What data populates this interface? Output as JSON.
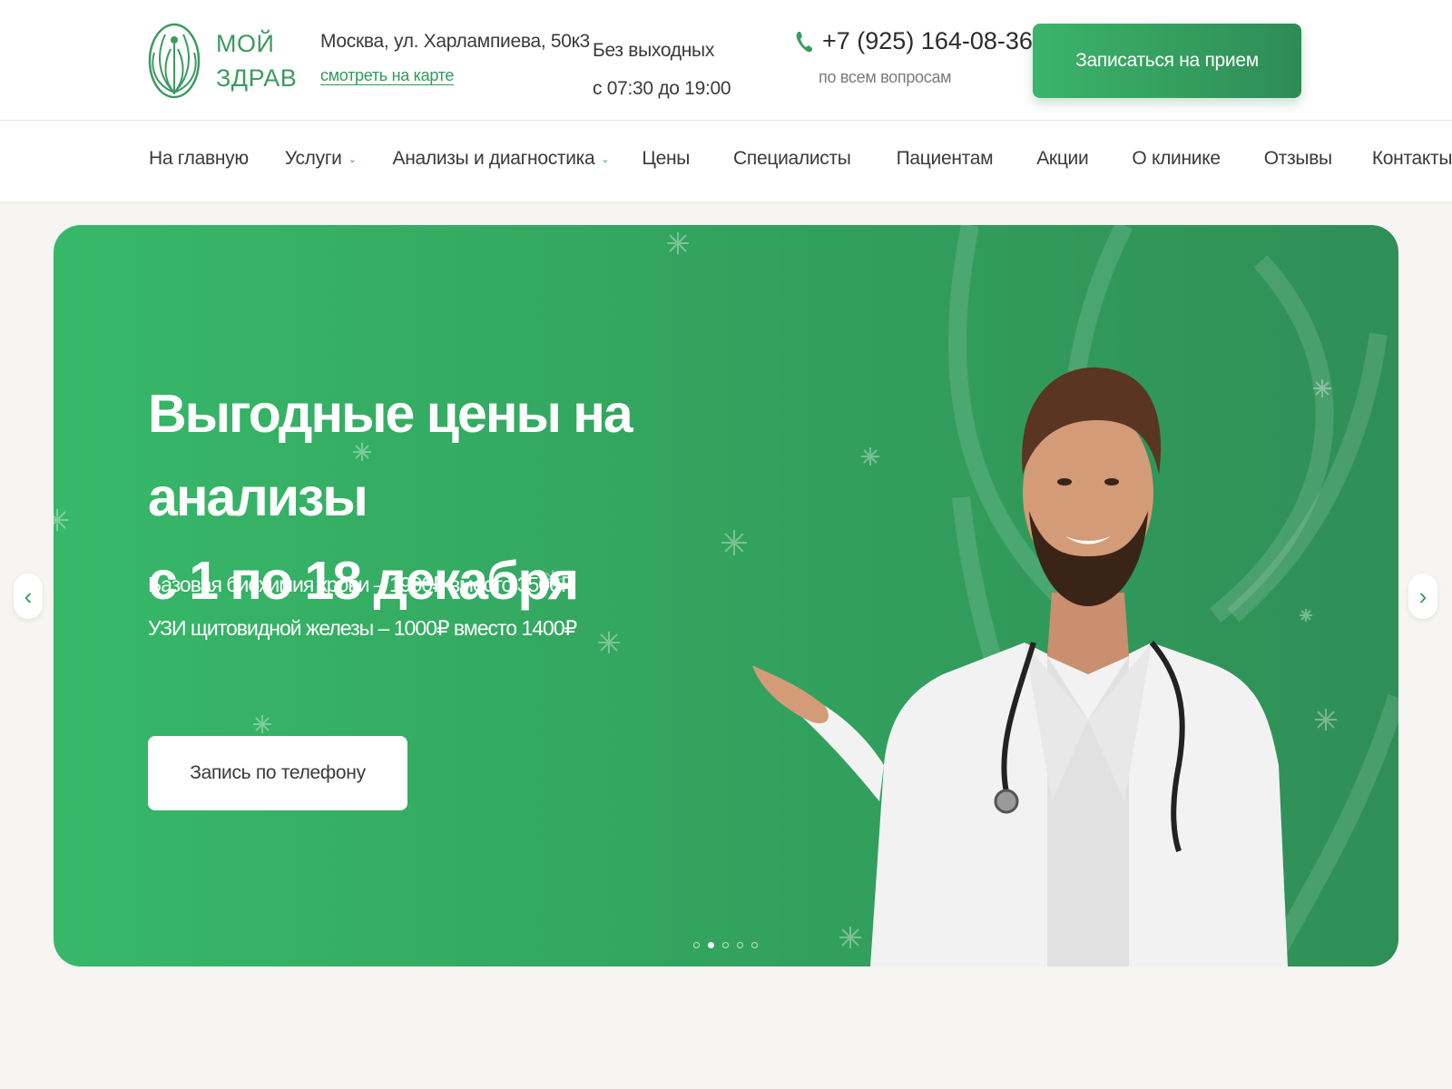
{
  "header": {
    "logo_line1": "МОЙ",
    "logo_line2": "ЗДРАВ",
    "address": "Москва, ул. Харлампиева, 50к3",
    "map_link": "смотреть на карте",
    "hours_line1": "Без выходных",
    "hours_line2": "с 07:30 до 19:00",
    "phone": "+7 (925) 164-08-36",
    "phone_sub": "по всем вопросам",
    "book_button": "Записаться на прием"
  },
  "nav": {
    "items": [
      {
        "label": "На главную",
        "dropdown": false
      },
      {
        "label": "Услуги",
        "dropdown": true
      },
      {
        "label": "Анализы и диагностика",
        "dropdown": true
      },
      {
        "label": "Цены",
        "dropdown": false
      },
      {
        "label": "Специалисты",
        "dropdown": false
      },
      {
        "label": "Пациентам",
        "dropdown": false
      },
      {
        "label": "Акции",
        "dropdown": false
      },
      {
        "label": "О клинике",
        "dropdown": false
      },
      {
        "label": "Отзывы",
        "dropdown": false
      },
      {
        "label": "Контакты",
        "dropdown": false
      }
    ],
    "chevron": "⌄"
  },
  "hero": {
    "title_line1": "Выгодные цены на анализы",
    "title_line2": "с 1 по 18 декабря",
    "offer_line1": "Базовая биохимия крови – 1900₽ вместо 3500₽",
    "offer_line2": "УЗИ щитовидной железы – 1000₽ вместо 1400₽",
    "phone_button": "Запись по телефону",
    "slides_total": 5,
    "active_slide": 2
  },
  "controls": {
    "prev_glyph": "‹",
    "next_glyph": "›"
  },
  "colors": {
    "brand_green": "#3c9a5f",
    "hero_start": "#37b869",
    "hero_end": "#2f8f57"
  }
}
